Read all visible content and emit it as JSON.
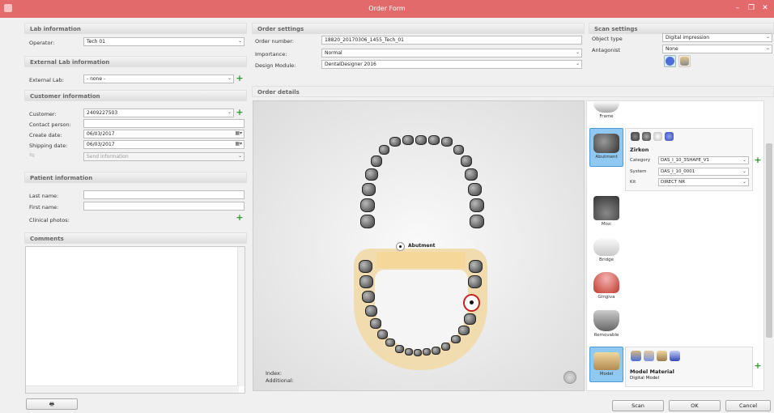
{
  "window": {
    "title": "Order Form"
  },
  "lab": {
    "header": "Lab information",
    "operator_label": "Operator:",
    "operator_value": "Tech 01",
    "external_header": "External Lab information",
    "external_label": "External Lab:",
    "external_value": "- none -"
  },
  "customer": {
    "header": "Customer information",
    "customer_label": "Customer:",
    "customer_value": "2409227503",
    "contact_label": "Contact person:",
    "create_label": "Create date:",
    "create_value": "06/03/2017",
    "shipping_label": "Shipping date:",
    "shipping_value": "06/03/2017",
    "send_info": "Send information"
  },
  "patient": {
    "header": "Patient information",
    "last_label": "Last name:",
    "first_label": "First name:",
    "photos_label": "Clinical photos:"
  },
  "comments": {
    "header": "Comments"
  },
  "order": {
    "header": "Order settings",
    "number_label": "Order number:",
    "number_value": "18820_20170306_1455_Tech_01",
    "importance_label": "Importance:",
    "importance_value": "Normal",
    "module_label": "Design Module:",
    "module_value": "DentalDesigner 2016"
  },
  "scan": {
    "header": "Scan settings",
    "object_label": "Object type",
    "object_value": "Digital impression",
    "antagonist_label": "Antagonist",
    "antagonist_value": "None"
  },
  "details": {
    "header": "Order details",
    "abutment_tag": "Abutment",
    "index_label": "Index:",
    "additional_label": "Additional:"
  },
  "types": {
    "frame": "Frame",
    "abutment": "Abutment",
    "misc": "Misc",
    "bridge": "Bridge",
    "gingiva": "Gingiva",
    "removable": "Removable",
    "model": "Model"
  },
  "material": {
    "name": "Zirkon",
    "category_label": "Category",
    "category_value": "DAS_I_10_3SHAPE_V1",
    "system_label": "System",
    "system_value": "DAS_I_10_0001",
    "kit_label": "Kit",
    "kit_value": "DIRECT NR"
  },
  "model_material": {
    "title": "Model Material",
    "subtitle": "Digital Model"
  },
  "footer": {
    "scan": "Scan",
    "ok": "OK",
    "cancel": "Cancel"
  },
  "icons": {
    "print": "print-icon",
    "plus": "add-icon",
    "dropdown": "chevron-down-icon",
    "calendar": "calendar-icon"
  }
}
